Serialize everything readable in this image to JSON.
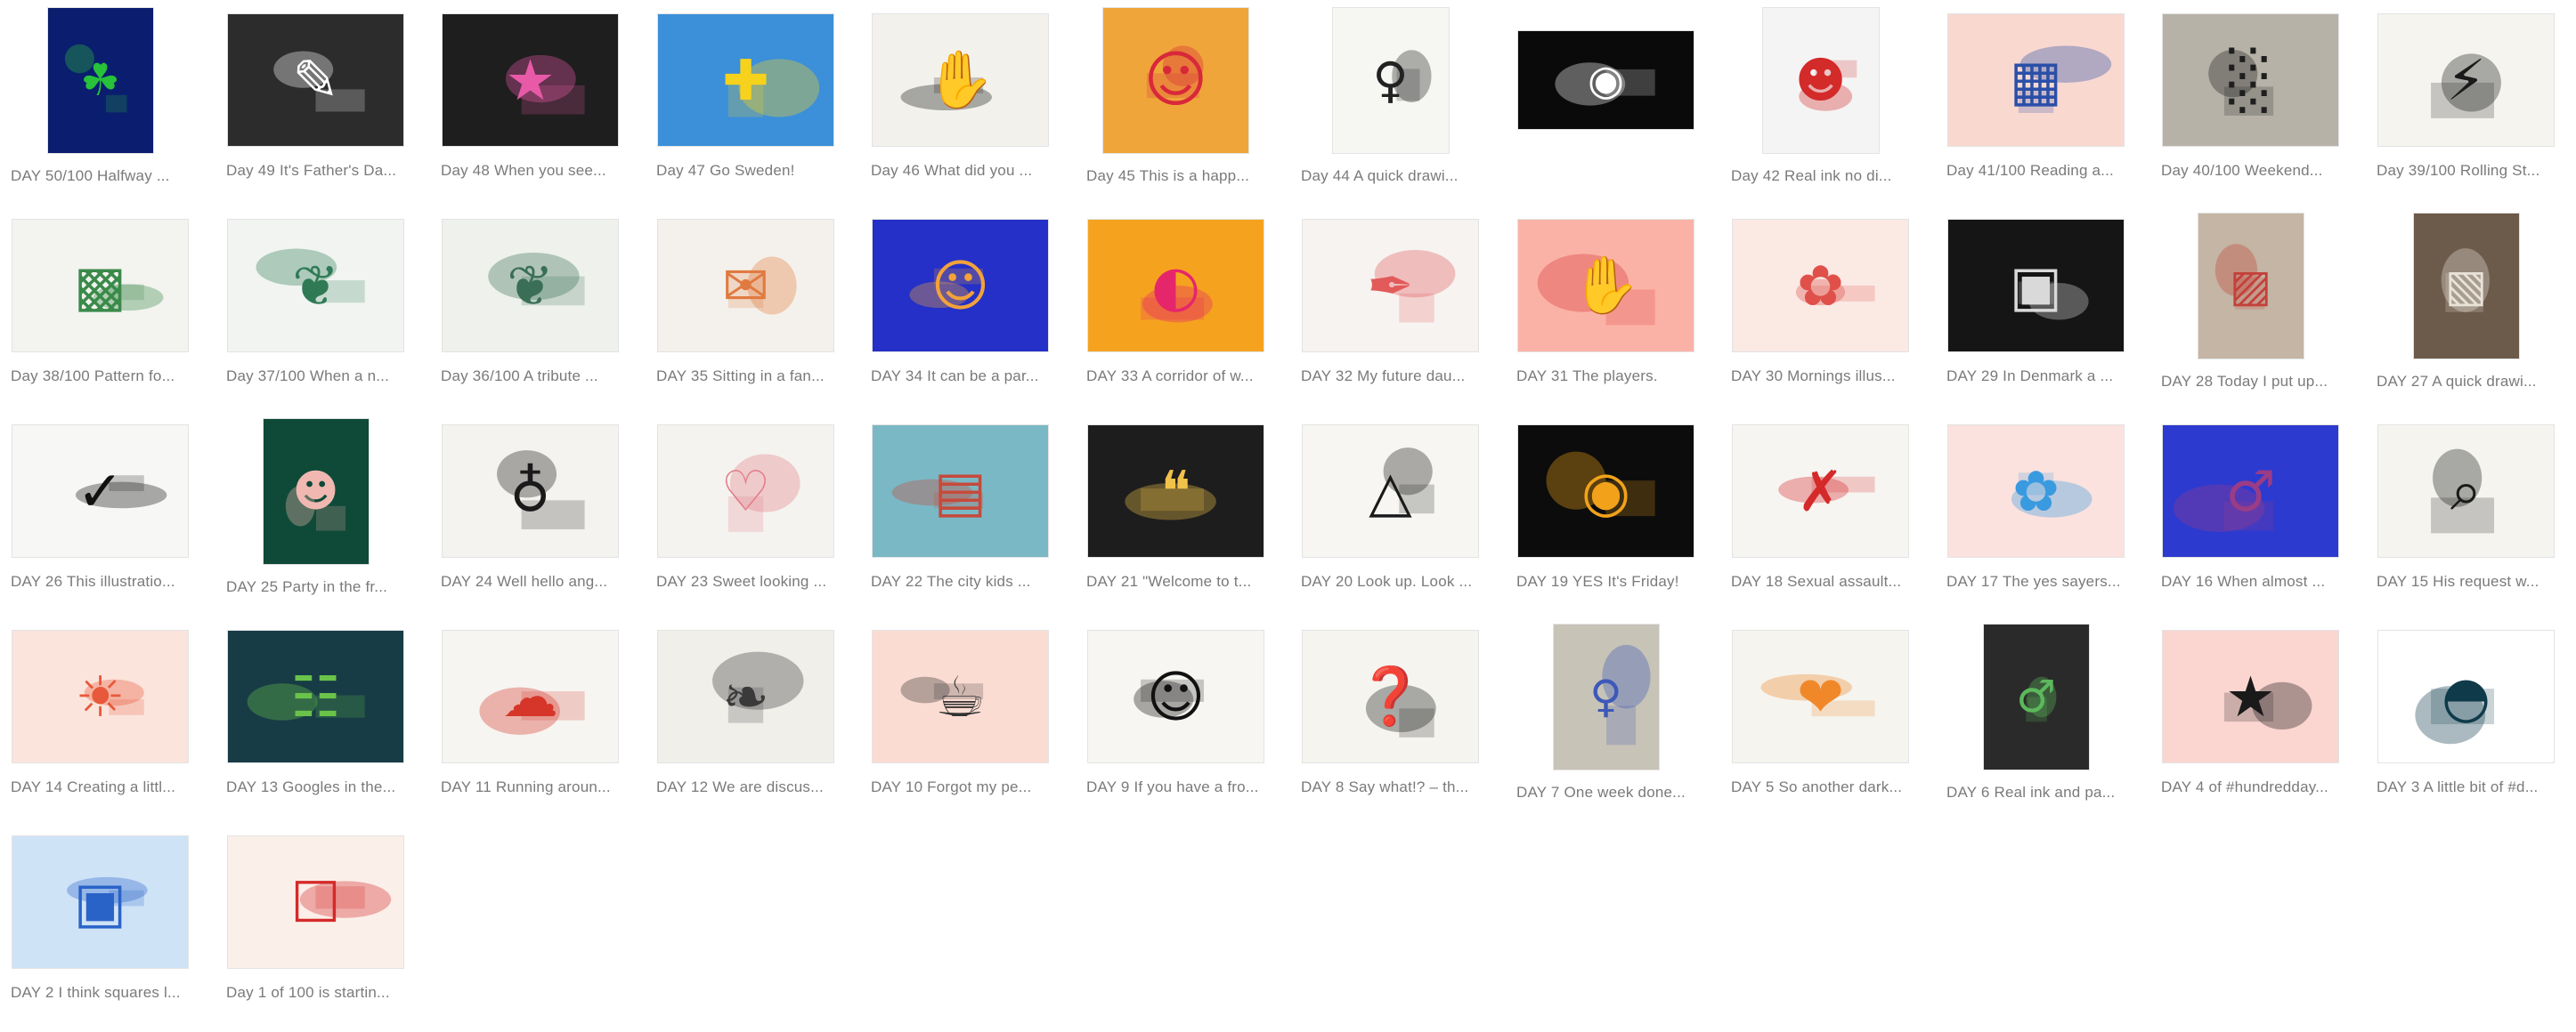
{
  "gallery": {
    "items": [
      {
        "caption": "DAY 50/100 Halfway ...",
        "bg": "#0b1d6e",
        "fg": "#27c13a",
        "icon": "palm-face-icon",
        "shape": "portrait"
      },
      {
        "caption": "Day 49 It's Father's Da...",
        "bg": "#2c2c2c",
        "fg": "#ffffff",
        "icon": "note-icon",
        "shape": "landscape"
      },
      {
        "caption": "Day 48  When you see...",
        "bg": "#1e1e1e",
        "fg": "#e85aa8",
        "icon": "rainbow-text-icon",
        "shape": "landscape"
      },
      {
        "caption": "Day 47 Go Sweden!",
        "bg": "#3c8fd9",
        "fg": "#f6d21c",
        "icon": "flag-icon",
        "shape": "landscape"
      },
      {
        "caption": "Day 46 What did you ...",
        "bg": "#f2f1ec",
        "fg": "#1a1a1a",
        "icon": "hand-shadow-icon",
        "shape": "landscape"
      },
      {
        "caption": "Day 45 This is a happ...",
        "bg": "#f0a53b",
        "fg": "#d8283a",
        "icon": "mask-face-icon",
        "shape": "portrait-wide"
      },
      {
        "caption": "Day 44 A quick drawi...",
        "bg": "#f6f6f2",
        "fg": "#222222",
        "icon": "sketch-figure-icon",
        "shape": "portrait-narrow"
      },
      {
        "caption": "",
        "bg": "#0a0a0a",
        "fg": "#ffffff",
        "icon": "eyes-icon",
        "shape": "banner"
      },
      {
        "caption": "Day 42 Real ink no di...",
        "bg": "#f4f4f4",
        "fg": "#d32a2a",
        "icon": "ink-face-icon",
        "shape": "portrait-narrow"
      },
      {
        "caption": "Day 41/100 Reading a...",
        "bg": "#f9d8d0",
        "fg": "#2a4fa8",
        "icon": "comic-panels-icon",
        "shape": "landscape"
      },
      {
        "caption": "Day 40/100  Weekend...",
        "bg": "#b6b2a8",
        "fg": "#1e1e1e",
        "icon": "candle-icon",
        "shape": "landscape"
      },
      {
        "caption": "Day 39/100 Rolling St...",
        "bg": "#f5f4ef",
        "fg": "#1a1a1a",
        "icon": "phone-thunder-icon",
        "shape": "landscape"
      },
      {
        "caption": "Day 38/100 Pattern fo...",
        "bg": "#f3f3ef",
        "fg": "#3a8a4a",
        "icon": "pattern-collage-icon",
        "shape": "landscape"
      },
      {
        "caption": "Day 37/100  When a n...",
        "bg": "#f1f4f1",
        "fg": "#2f7a55",
        "icon": "pattern-icon",
        "shape": "landscape"
      },
      {
        "caption": "Day 36/100 A tribute ...",
        "bg": "#eef1ec",
        "fg": "#3a6f56",
        "icon": "pattern-icon",
        "shape": "landscape"
      },
      {
        "caption": "DAY 35 Sitting in a fan...",
        "bg": "#f4f1ec",
        "fg": "#e17a40",
        "icon": "postcards-icon",
        "shape": "landscape"
      },
      {
        "caption": "DAY 34 It can be a par...",
        "bg": "#2430c7",
        "fg": "#f2a23a",
        "icon": "portrait-icon",
        "shape": "landscape"
      },
      {
        "caption": "DAY 33 A corridor of w...",
        "bg": "#f5a31f",
        "fg": "#e6266b",
        "icon": "corridor-face-icon",
        "shape": "landscape"
      },
      {
        "caption": "DAY 32 My future dau...",
        "bg": "#f6f3f0",
        "fg": "#e25a5a",
        "icon": "line-drawing-icon",
        "shape": "landscape"
      },
      {
        "caption": "DAY 31 The players.",
        "bg": "#fbb2a6",
        "fg": "#d8363a",
        "icon": "hand-icon",
        "shape": "landscape"
      },
      {
        "caption": "DAY 30 Mornings illus...",
        "bg": "#fbe9e4",
        "fg": "#e0504a",
        "icon": "flower-face-icon",
        "shape": "landscape"
      },
      {
        "caption": "DAY 29 In Denmark a ...",
        "bg": "#151515",
        "fg": "#d9d9d9",
        "icon": "building-icon",
        "shape": "landscape"
      },
      {
        "caption": "DAY 28 Today I put up...",
        "bg": "#c4b5a4",
        "fg": "#c3413a",
        "icon": "framed-art-icon",
        "shape": "portrait"
      },
      {
        "caption": "DAY 27 A quick drawi...",
        "bg": "#6c5a4a",
        "fg": "#e8e2d8",
        "icon": "framed-sketch-icon",
        "shape": "portrait"
      },
      {
        "caption": "DAY 26 This illustratio...",
        "bg": "#f7f7f5",
        "fg": "#111111",
        "icon": "to-do-icon",
        "shape": "landscape"
      },
      {
        "caption": "DAY 25 Party in the fr...",
        "bg": "#0f4a38",
        "fg": "#f0b8b0",
        "icon": "masked-figure-icon",
        "shape": "portrait"
      },
      {
        "caption": "DAY 24 Well hello ang...",
        "bg": "#f4f3ef",
        "fg": "#1a1a1a",
        "icon": "sitting-figure-icon",
        "shape": "landscape"
      },
      {
        "caption": "DAY 23 Sweet looking ...",
        "bg": "#f4f3ef",
        "fg": "#e37d8a",
        "icon": "please-instagram-icon",
        "shape": "landscape"
      },
      {
        "caption": "DAY 22 The city kids ...",
        "bg": "#7ab8c5",
        "fg": "#c64a3a",
        "icon": "city-icon",
        "shape": "landscape"
      },
      {
        "caption": "DAY 21 \"Welcome to t...",
        "bg": "#1d1d1d",
        "fg": "#f1c24a",
        "icon": "speech-bubble-icon",
        "shape": "landscape"
      },
      {
        "caption": "DAY 20 Look up. Look ...",
        "bg": "#f7f6f2",
        "fg": "#1a1a1a",
        "icon": "dress-icon",
        "shape": "landscape"
      },
      {
        "caption": "DAY 19 YES It's Friday!",
        "bg": "#0c0c0c",
        "fg": "#f2a21a",
        "icon": "yes-eyes-icon",
        "shape": "landscape"
      },
      {
        "caption": "DAY 18 Sexual assault...",
        "bg": "#f7f5f2",
        "fg": "#d42a2a",
        "icon": "closet-icon",
        "shape": "landscape"
      },
      {
        "caption": "DAY 17 The yes sayers...",
        "bg": "#fbe2de",
        "fg": "#3a9ae0",
        "icon": "yes-flowers-icon",
        "shape": "landscape"
      },
      {
        "caption": "DAY 16 When almost ...",
        "bg": "#2c3ad0",
        "fg": "#9a3c86",
        "icon": "figure-icon",
        "shape": "landscape"
      },
      {
        "caption": "DAY 15 His request w...",
        "bg": "#f5f4ef",
        "fg": "#1a1a1a",
        "icon": "find-theme-icon",
        "shape": "landscape"
      },
      {
        "caption": "DAY 14 Creating a littl...",
        "bg": "#fbe4dc",
        "fg": "#e8583a",
        "icon": "weekend-icon",
        "shape": "landscape"
      },
      {
        "caption": "DAY 13 Googles in the...",
        "bg": "#173c46",
        "fg": "#6ac24a",
        "icon": "crowd-icon",
        "shape": "landscape"
      },
      {
        "caption": "DAY 11 Running aroun...",
        "bg": "#f6f5f1",
        "fg": "#d6362a",
        "icon": "free-mind-icon",
        "shape": "landscape"
      },
      {
        "caption": "DAY 12 We are discus...",
        "bg": "#f1efea",
        "fg": "#3a3a3a",
        "icon": "bird-head-icon",
        "shape": "landscape"
      },
      {
        "caption": "DAY 10  Forgot my pe...",
        "bg": "#fbdcd2",
        "fg": "#333333",
        "icon": "cat-icon",
        "shape": "landscape"
      },
      {
        "caption": "DAY 9 If you have a fro...",
        "bg": "#f7f6f2",
        "fg": "#111111",
        "icon": "profile-icon",
        "shape": "landscape"
      },
      {
        "caption": "DAY 8 Say what!? – th...",
        "bg": "#f5f4ef",
        "fg": "#1a1a1a",
        "icon": "thinking-icon",
        "shape": "landscape"
      },
      {
        "caption": "DAY 7 One week done...",
        "bg": "#c7c3b7",
        "fg": "#3d58b8",
        "icon": "hanging-print-icon",
        "shape": "portrait"
      },
      {
        "caption": "DAY 5 So another dark...",
        "bg": "#f5f4ef",
        "fg": "#f0882a",
        "icon": "child-in-need-icon",
        "shape": "landscape"
      },
      {
        "caption": "DAY 6 Real ink and pa...",
        "bg": "#2a2a2a",
        "fg": "#5cb85c",
        "icon": "ink-figure-icon",
        "shape": "portrait"
      },
      {
        "caption": "DAY 4 of #hundredday...",
        "bg": "#fbd5d0",
        "fg": "#1a1a1a",
        "icon": "big-icon",
        "shape": "landscape"
      },
      {
        "caption": "DAY 3 A little bit of #d...",
        "bg": "#ffffff",
        "fg": "#0f3a4a",
        "icon": "bowl-icon",
        "shape": "landscape"
      },
      {
        "caption": "DAY 2 I think squares l...",
        "bg": "#cfe3f7",
        "fg": "#2a63c8",
        "icon": "squares-icon",
        "shape": "landscape"
      },
      {
        "caption": "Day 1 of 100 is startin...",
        "bg": "#fbefe9",
        "fg": "#d42a2a",
        "icon": "robot-note-icon",
        "shape": "landscape"
      }
    ]
  }
}
